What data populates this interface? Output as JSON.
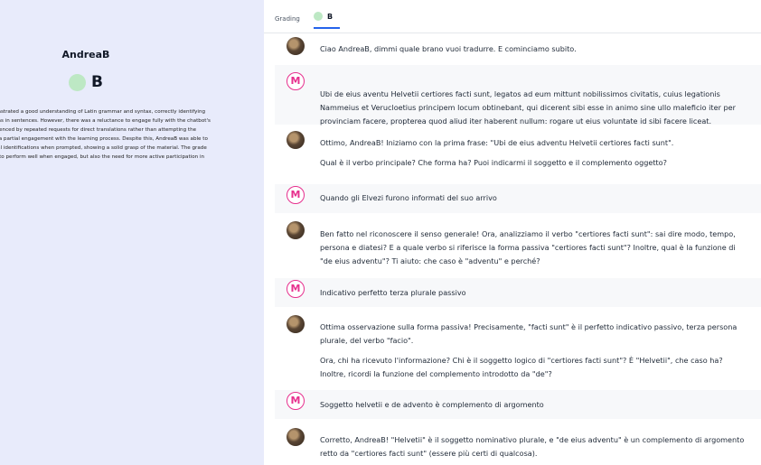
{
  "student": {
    "name": "AndreaB",
    "grade": "B",
    "summary_lines": [
      "onstrated a good understanding of Latin grammar and syntax, correctly identifying",
      "ons in sentences. However, there was a reluctance to engage fully with the chatbot's",
      "idenced by repeated requests for direct translations rather than attempting the",
      "s a partial engagement with the learning process. Despite this, AndreaB was able to",
      "cal identifications when prompted, showing a solid grasp of the material. The grade",
      "y to perform well when engaged, but also the need for more active participation in"
    ]
  },
  "tabs": {
    "grading": "Grading",
    "grade": "B"
  },
  "messages": [
    {
      "role": "bot",
      "paragraphs": [
        "Ciao AndreaB, dimmi quale brano vuoi tradurre. E cominciamo subito."
      ]
    },
    {
      "role": "user",
      "avatar_letter": "M",
      "paragraphs": [
        "Ubi de eius aventu Helvetii certiores facti sunt, legatos ad eum mittunt nobilissimos civitatis, cuius legationis Nammeius et Verucloetius principem locum obtinebant, qui dicerent sibi esse in animo sine ullo maleficio iter per provinciam facere, propterea quod aliud iter haberent nullum: rogare ut eius voluntate id sibi facere liceat."
      ]
    },
    {
      "role": "bot",
      "paragraphs": [
        "Ottimo, AndreaB! Iniziamo con la prima frase: \"Ubi de eius adventu Helvetii certiores facti sunt\".",
        "Qual è il verbo principale? Che forma ha? Puoi indicarmi il soggetto e il complemento oggetto?"
      ]
    },
    {
      "role": "user",
      "avatar_letter": "M",
      "paragraphs": [
        "Quando gli Elvezi furono informati del suo arrivo"
      ]
    },
    {
      "role": "bot",
      "paragraphs": [
        "Ben fatto nel riconoscere il senso generale! Ora, analizziamo il verbo \"certiores facti sunt\": sai dire modo, tempo, persona e diatesi? E a quale verbo si riferisce la forma passiva \"certiores facti sunt\"? Inoltre, qual è la funzione di \"de eius adventu\"? Ti aiuto: che caso è \"adventu\" e perché?"
      ]
    },
    {
      "role": "user",
      "avatar_letter": "M",
      "paragraphs": [
        "Indicativo perfetto terza plurale passivo"
      ]
    },
    {
      "role": "bot",
      "paragraphs": [
        "Ottima osservazione sulla forma passiva! Precisamente, \"facti sunt\" è il perfetto indicativo passivo, terza persona plurale, del verbo \"facio\".",
        "Ora, chi ha ricevuto l'informazione? Chi è il soggetto logico di \"certiores facti sunt\"? È \"Helvetii\", che caso ha? Inoltre, ricordi la funzione del complemento introdotto da \"de\"?"
      ]
    },
    {
      "role": "user",
      "avatar_letter": "M",
      "paragraphs": [
        "Soggetto helvetii e de advento è complemento di argomento"
      ]
    },
    {
      "role": "bot",
      "paragraphs": [
        "Corretto, AndreaB! \"Helvetii\" è il soggetto nominativo plurale, e \"de eius adventu\" è un complemento di argomento retto da \"certiores facti sunt\" (essere più certi di qualcosa)."
      ]
    }
  ]
}
